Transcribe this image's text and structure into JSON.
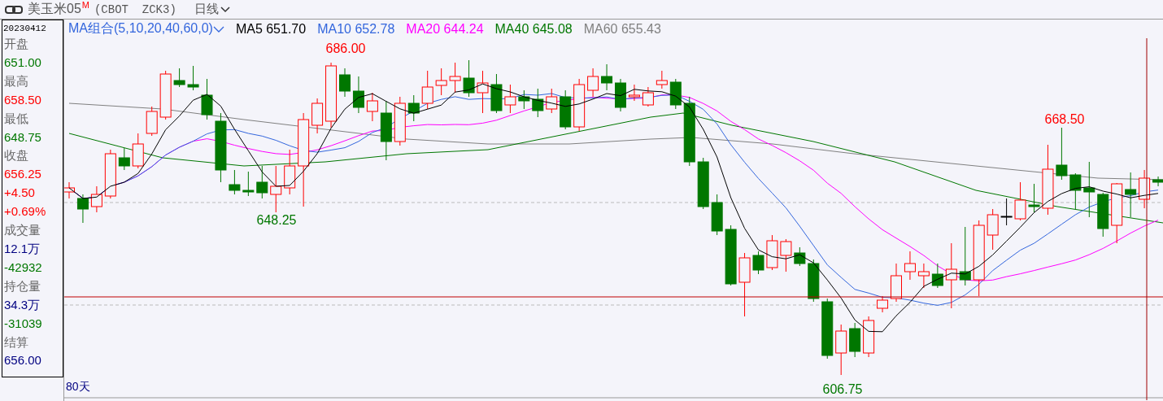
{
  "header": {
    "title": "美玉米05",
    "superscript": "M",
    "symbol": "(CBOT  ZCK3)",
    "period": "日线"
  },
  "ma_legend": {
    "selector": "MA组合(5,10,20,40,60,0)",
    "items": [
      {
        "label": "MA5 651.70",
        "color": "#000000"
      },
      {
        "label": "MA10 652.78",
        "color": "#3366dd"
      },
      {
        "label": "MA20 644.24",
        "color": "#ff00ff"
      },
      {
        "label": "MA40 645.08",
        "color": "#007700"
      },
      {
        "label": "MA60 655.43",
        "color": "#808080"
      }
    ]
  },
  "info_panel": {
    "date": "20230412",
    "lines": [
      {
        "kind": "label",
        "text": "开盘"
      },
      {
        "kind": "value",
        "text": "651.00",
        "color": "#007700"
      },
      {
        "kind": "label",
        "text": "最高"
      },
      {
        "kind": "value",
        "text": "658.50",
        "color": "#ff0000"
      },
      {
        "kind": "label",
        "text": "最低"
      },
      {
        "kind": "value",
        "text": "648.75",
        "color": "#007700"
      },
      {
        "kind": "label",
        "text": "收盘"
      },
      {
        "kind": "value",
        "text": "656.25",
        "color": "#ff0000"
      },
      {
        "kind": "value",
        "text": "+4.50",
        "color": "#ff0000"
      },
      {
        "kind": "value",
        "text": "+0.69%",
        "color": "#ff0000"
      },
      {
        "kind": "label",
        "text": "成交量"
      },
      {
        "kind": "value",
        "text": "12.1万",
        "color": "#000080"
      },
      {
        "kind": "value",
        "text": "-42932",
        "color": "#007700"
      },
      {
        "kind": "label",
        "text": "持仓量"
      },
      {
        "kind": "value",
        "text": "34.3万",
        "color": "#000080"
      },
      {
        "kind": "value",
        "text": "-31039",
        "color": "#007700"
      },
      {
        "kind": "label",
        "text": "结算"
      },
      {
        "kind": "value",
        "text": "656.00",
        "color": "#000080"
      }
    ]
  },
  "chart": {
    "annotations": [
      {
        "text": "686.00",
        "color": "#ff0000"
      },
      {
        "text": "648.25",
        "color": "#007700"
      },
      {
        "text": "606.75",
        "color": "#007700"
      },
      {
        "text": "668.50",
        "color": "#ff0000"
      }
    ],
    "period_label": "80天"
  }
}
